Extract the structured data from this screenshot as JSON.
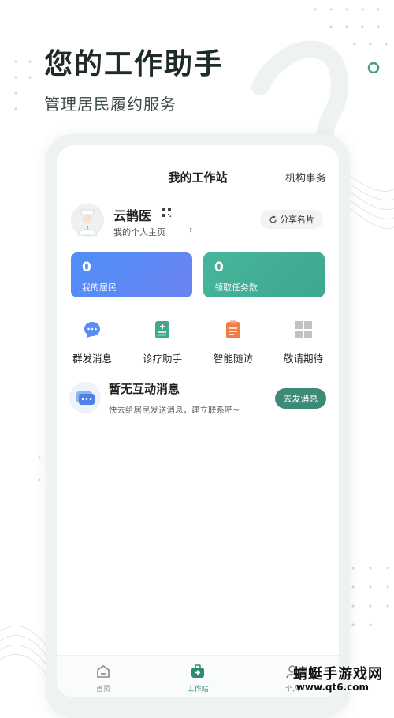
{
  "hero": {
    "title": "您的工作助手",
    "subtitle": "管理居民履约服务"
  },
  "topbar": {
    "title": "我的工作站",
    "right_action": "机构事务"
  },
  "profile": {
    "name": "云鹊医",
    "homepage_link": "我的个人主页",
    "share_button": "分享名片"
  },
  "stats": [
    {
      "value": "0",
      "label": "我的居民",
      "color": "#5b8cf4"
    },
    {
      "value": "0",
      "label": "领取任务数",
      "color": "#45b097"
    }
  ],
  "tools": [
    {
      "label": "群发消息",
      "icon": "chat-bubble-icon"
    },
    {
      "label": "诊疗助手",
      "icon": "clipboard-plus-icon"
    },
    {
      "label": "智能随访",
      "icon": "clipboard-list-icon"
    },
    {
      "label": "敬请期待",
      "icon": "grid-icon"
    }
  ],
  "message": {
    "title": "暂无互动消息",
    "description": "快去给居民发送消息，建立联系吧~",
    "button": "去发消息"
  },
  "tabbar": {
    "tabs": [
      {
        "label": "首页",
        "icon": "home-icon"
      },
      {
        "label": "工作站",
        "icon": "medkit-icon",
        "active": true
      },
      {
        "label": "个人",
        "icon": "person-icon"
      }
    ]
  },
  "watermark": {
    "line1": "蜻蜓手游戏网",
    "line2": "www.qt6.com"
  },
  "colors": {
    "accent": "#3d8a79",
    "blue": "#4f8ef7",
    "green": "#47b59d"
  }
}
